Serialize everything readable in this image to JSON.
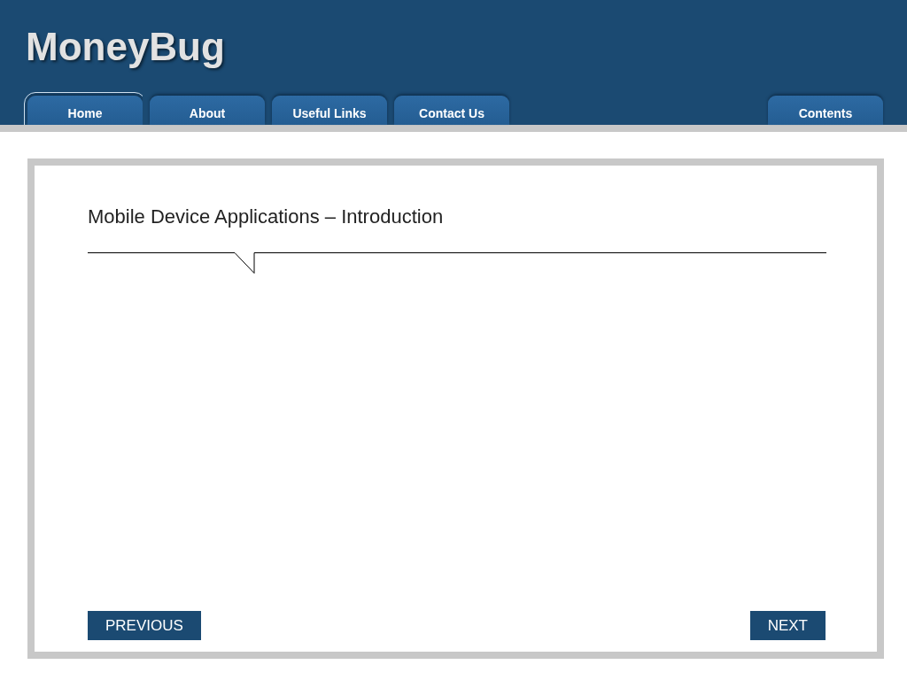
{
  "logo": "MoneyBug",
  "tabs": [
    {
      "label": "Home",
      "selected": true
    },
    {
      "label": "About",
      "selected": false
    },
    {
      "label": "Useful Links",
      "selected": false
    },
    {
      "label": "Contact Us",
      "selected": false
    }
  ],
  "contents_tab": {
    "label": "Contents",
    "selected": false
  },
  "page": {
    "title": "Mobile Device Applications – Introduction"
  },
  "buttons": {
    "previous": "PREVIOUS",
    "next": "NEXT"
  }
}
